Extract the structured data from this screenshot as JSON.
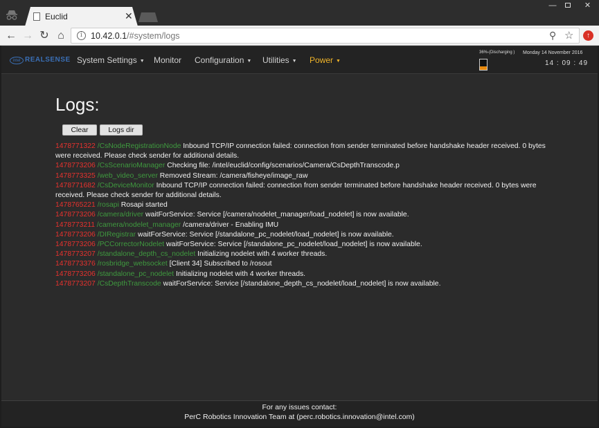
{
  "browser": {
    "tab_title": "Euclid",
    "tab_close": "✕",
    "url_host": "10.42.0.1",
    "url_path": "/#system/logs"
  },
  "navbar": {
    "brand": "REALSENSE",
    "brand_mark": "intel",
    "menus": [
      {
        "label": "System Settings",
        "has_caret": true
      },
      {
        "label": "Monitor",
        "has_caret": false
      },
      {
        "label": "Configuration",
        "has_caret": true
      },
      {
        "label": "Utilities",
        "has_caret": true
      },
      {
        "label": "Power",
        "has_caret": true
      }
    ],
    "power_color": "#f0b429",
    "battery_status": "36%-(Discharging )",
    "battery_level": 0.36,
    "date": "Monday 14 November 2016",
    "time": "14 : 09 : 49"
  },
  "page": {
    "title": "Logs:",
    "clear_button": "Clear",
    "logs_dir_button": "Logs dir"
  },
  "colors": {
    "timestamp": "#e8322e",
    "node": "#3f9a3f"
  },
  "logs": [
    {
      "ts": "1478771322",
      "node": "/CsNodeRegistrationNode",
      "msg": "Inbound TCP/IP connection failed: connection from sender terminated before handshake header received. 0 bytes were received. Please check sender for additional details."
    },
    {
      "ts": "1478773206",
      "node": "/CsScenarioManager",
      "msg": "Checking file: /intel/euclid/config/scenarios/Camera/CsDepthTranscode.p"
    },
    {
      "ts": "1478773325",
      "node": "/web_video_server",
      "msg": "Removed Stream: /camera/fisheye/image_raw"
    },
    {
      "ts": "1478771682",
      "node": "/CsDeviceMonitor",
      "msg": "Inbound TCP/IP connection failed: connection from sender terminated before handshake header received. 0 bytes were received. Please check sender for additional details."
    },
    {
      "ts": "1478765221",
      "node": "/rosapi",
      "msg": "Rosapi started"
    },
    {
      "ts": "1478773206",
      "node": "/camera/driver",
      "msg": "waitForService: Service [/camera/nodelet_manager/load_nodelet] is now available."
    },
    {
      "ts": "1478773211",
      "node": "/camera/nodelet_manager",
      "msg": "/camera/driver - Enabling IMU"
    },
    {
      "ts": "1478773206",
      "node": "/DIRegistrar",
      "msg": "waitForService: Service [/standalone_pc_nodelet/load_nodelet] is now available."
    },
    {
      "ts": "1478773206",
      "node": "/PCCorrectorNodelet",
      "msg": "waitForService: Service [/standalone_pc_nodelet/load_nodelet] is now available."
    },
    {
      "ts": "1478773207",
      "node": "/standalone_depth_cs_nodelet",
      "msg": "Initializing nodelet with 4 worker threads."
    },
    {
      "ts": "1478773376",
      "node": "/rosbridge_websocket",
      "msg": "[Client 34] Subscribed to /rosout"
    },
    {
      "ts": "1478773206",
      "node": "/standalone_pc_nodelet",
      "msg": "Initializing nodelet with 4 worker threads."
    },
    {
      "ts": "1478773207",
      "node": "/CsDepthTranscode",
      "msg": "waitForService: Service [/standalone_depth_cs_nodelet/load_nodelet] is now available."
    }
  ],
  "footer": {
    "line1": "For any issues contact:",
    "line2": "PerC Robotics Innovation Team at (perc.robotics.innovation@intel.com)"
  }
}
